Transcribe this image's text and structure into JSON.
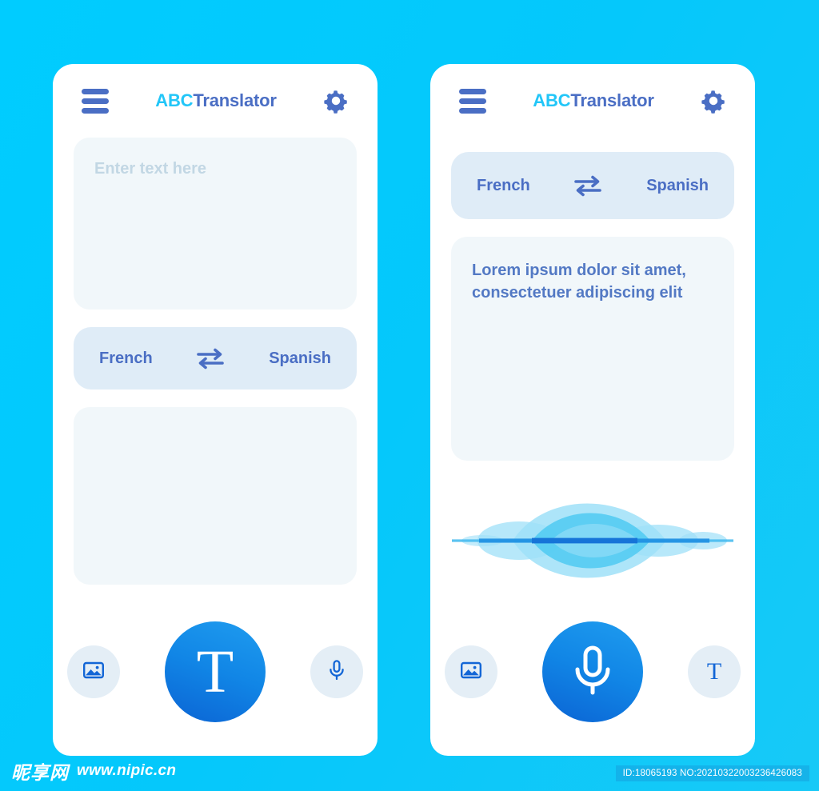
{
  "background_color": "#00ccff",
  "brand": {
    "title_accent": "ABC",
    "title_rest": "Translator",
    "accent_color": "#22c6f8",
    "title_color": "#4a6ec4",
    "primary_blue": "#1186e6"
  },
  "screens": [
    {
      "id": "text-input-screen",
      "appbar": {
        "menu_icon": "hamburger-icon",
        "title_accent": "ABC",
        "title_rest": "Translator",
        "settings_icon": "gear-icon"
      },
      "input_panel": {
        "placeholder": "Enter text here",
        "value": ""
      },
      "language_bar": {
        "source": "French",
        "target": "Spanish",
        "swap_icon": "swap-arrows-icon"
      },
      "result_panel": {
        "value": ""
      },
      "actions": {
        "left": {
          "icon": "image-icon",
          "label": ""
        },
        "center": {
          "icon": "text-icon",
          "label": "T",
          "active": true
        },
        "right": {
          "icon": "microphone-icon",
          "label": ""
        }
      }
    },
    {
      "id": "voice-input-screen",
      "appbar": {
        "menu_icon": "hamburger-icon",
        "title_accent": "ABC",
        "title_rest": "Translator",
        "settings_icon": "gear-icon"
      },
      "language_bar": {
        "source": "French",
        "target": "Spanish",
        "swap_icon": "swap-arrows-icon"
      },
      "output_panel": {
        "value": "Lorem ipsum dolor sit amet, consectetuer adipiscing elit"
      },
      "waveform": {
        "icon": "audio-waveform",
        "color_light": "#9fe0f8",
        "color_mid": "#4fcaf2",
        "color_line": "#1674d8"
      },
      "actions": {
        "left": {
          "icon": "image-icon",
          "label": ""
        },
        "center": {
          "icon": "microphone-icon",
          "label": "",
          "active": true
        },
        "right": {
          "icon": "text-icon",
          "label": "T"
        }
      }
    }
  ],
  "watermark": {
    "logo": "昵享网",
    "url": "www.nipic.cn"
  },
  "id_badge": {
    "text": "ID:18065193 NO:20210322003236426083"
  }
}
